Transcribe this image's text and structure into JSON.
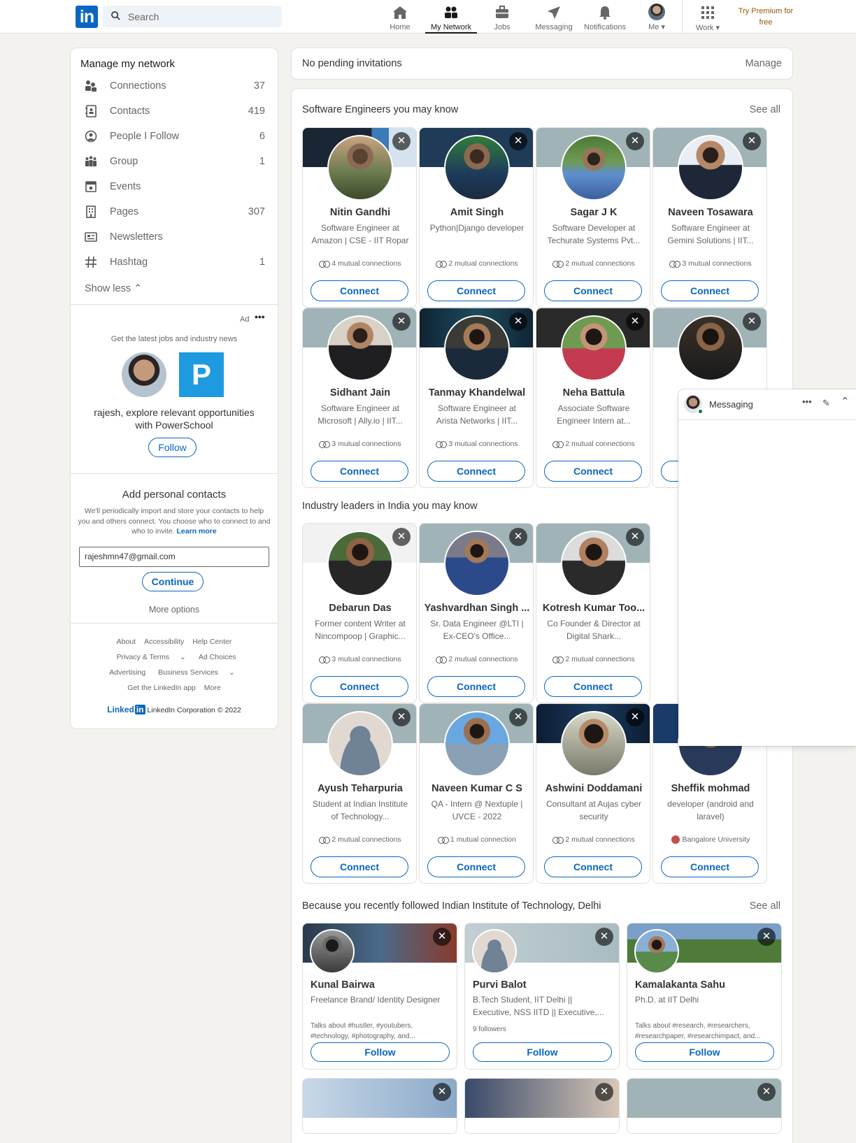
{
  "nav": {
    "search_placeholder": "Search",
    "items": [
      {
        "label": "Home",
        "icon": "home-icon"
      },
      {
        "label": "My Network",
        "icon": "network-icon",
        "active": true
      },
      {
        "label": "Jobs",
        "icon": "briefcase-icon"
      },
      {
        "label": "Messaging",
        "icon": "send-icon"
      },
      {
        "label": "Notifications",
        "icon": "bell-icon"
      },
      {
        "label": "Me",
        "icon": "avatar"
      },
      {
        "label": "Work",
        "icon": "grid-icon"
      }
    ],
    "premium": "Try Premium for free"
  },
  "sidebar": {
    "title": "Manage my network",
    "items": [
      {
        "label": "Connections",
        "count": "37",
        "icon": "connections-icon"
      },
      {
        "label": "Contacts",
        "count": "419",
        "icon": "contacts-icon"
      },
      {
        "label": "People I Follow",
        "count": "6",
        "icon": "follow-icon"
      },
      {
        "label": "Group",
        "count": "1",
        "icon": "group-icon"
      },
      {
        "label": "Events",
        "count": "",
        "icon": "calendar-icon"
      },
      {
        "label": "Pages",
        "count": "307",
        "icon": "pages-icon"
      },
      {
        "label": "Newsletters",
        "count": "",
        "icon": "newsletter-icon"
      },
      {
        "label": "Hashtag",
        "count": "1",
        "icon": "hashtag-icon"
      }
    ],
    "show_less": "Show less"
  },
  "ad": {
    "label": "Ad",
    "tagline": "Get the latest jobs and industry news",
    "text": "rajesh, explore relevant opportunities with PowerSchool",
    "button": "Follow"
  },
  "contacts": {
    "title": "Add personal contacts",
    "text": "We'll periodically import and store your contacts to help you and others connect. You choose who to connect to and who to invite.",
    "learn_more": "Learn more",
    "email": "rajeshmn47@gmail.com",
    "continue": "Continue",
    "more": "More options"
  },
  "footer": {
    "row1": [
      "About",
      "Accessibility",
      "Help Center"
    ],
    "row2": [
      "Privacy & Terms",
      "Ad Choices"
    ],
    "row3": [
      "Advertising",
      "Business Services"
    ],
    "row4": [
      "Get the LinkedIn app",
      "More"
    ],
    "brand": "Linked",
    "brand_in": "in",
    "copyright": "LinkedIn Corporation © 2022"
  },
  "invitations": {
    "text": "No pending invitations",
    "manage": "Manage"
  },
  "section1": {
    "title": "Software Engineers you may know",
    "see_all": "See all",
    "people": [
      {
        "name": "Nitin Gandhi",
        "headline": "Software Engineer at Amazon | CSE - IIT Ropar",
        "mutual": "4 mutual connections",
        "connect": "Connect"
      },
      {
        "name": "Amit Singh",
        "headline": "Python|Django developer",
        "mutual": "2 mutual connections",
        "connect": "Connect"
      },
      {
        "name": "Sagar J K",
        "headline": "Software Developer at Techurate Systems Pvt...",
        "mutual": "2 mutual connections",
        "connect": "Connect"
      },
      {
        "name": "Naveen Tosawara",
        "headline": "Software Engineer at Gemini Solutions | IIT...",
        "mutual": "3 mutual connections",
        "connect": "Connect"
      },
      {
        "name": "Sidhant Jain",
        "headline": "Software Engineer at Microsoft | Ally.io | IIT...",
        "mutual": "3 mutual connections",
        "connect": "Connect"
      },
      {
        "name": "Tanmay Khandelwal",
        "headline": "Software Engineer at Arista Networks | IIT...",
        "mutual": "3 mutual connections",
        "connect": "Connect"
      },
      {
        "name": "Neha Battula",
        "headline": "Associate Software Engineer Intern at...",
        "mutual": "2 mutual connections",
        "connect": "Connect"
      },
      {
        "name": "",
        "headline": "",
        "mutual": "",
        "connect": "Connect"
      }
    ]
  },
  "section2": {
    "title": "Industry leaders in India you may know",
    "people": [
      {
        "name": "Debarun Das",
        "headline": "Former content Writer at Nincompoop | Graphic...",
        "mutual": "3 mutual connections",
        "connect": "Connect"
      },
      {
        "name": "Yashvardhan Singh ...",
        "headline": "Sr. Data Engineer @LTI | Ex-CEO's Office...",
        "mutual": "2 mutual connections",
        "connect": "Connect"
      },
      {
        "name": "Kotresh Kumar Too...",
        "headline": "Co Founder & Director at Digital Shark...",
        "mutual": "2 mutual connections",
        "connect": "Connect"
      },
      {
        "name": "Ayush Teharpuria",
        "headline": "Student at Indian Institute of Technology...",
        "mutual": "2 mutual connections",
        "connect": "Connect"
      },
      {
        "name": "Naveen Kumar C S",
        "headline": "QA - Intern @ Nextuple | UVCE - 2022",
        "mutual": "1 mutual connection",
        "connect": "Connect"
      },
      {
        "name": "Ashwini Doddamani",
        "headline": "Consultant at Aujas cyber security",
        "mutual": "2 mutual connections",
        "connect": "Connect"
      },
      {
        "name": "Sheffik mohmad",
        "headline": "developer (android and laravel)",
        "mutual": "Bangalore University",
        "connect": "Connect"
      }
    ]
  },
  "section3": {
    "title": "Because you recently followed Indian Institute of Technology, Delhi",
    "see_all": "See all",
    "people": [
      {
        "name": "Kunal Bairwa",
        "headline": "Freelance Brand/ Identity Designer",
        "meta": "Talks about #hustler, #youtubers, #technology, #photography, and...",
        "follow": "Follow"
      },
      {
        "name": "Purvi Balot",
        "headline": "B.Tech Student, IIT Delhi || Executive, NSS IITD || Executive,...",
        "meta": "9 followers",
        "follow": "Follow"
      },
      {
        "name": "Kamalakanta Sahu",
        "headline": "Ph.D. at IIT Delhi",
        "meta": "Talks about #research, #researchers, #researchpaper, #researchimpact, and...",
        "follow": "Follow"
      }
    ]
  },
  "messaging": {
    "title": "Messaging"
  }
}
